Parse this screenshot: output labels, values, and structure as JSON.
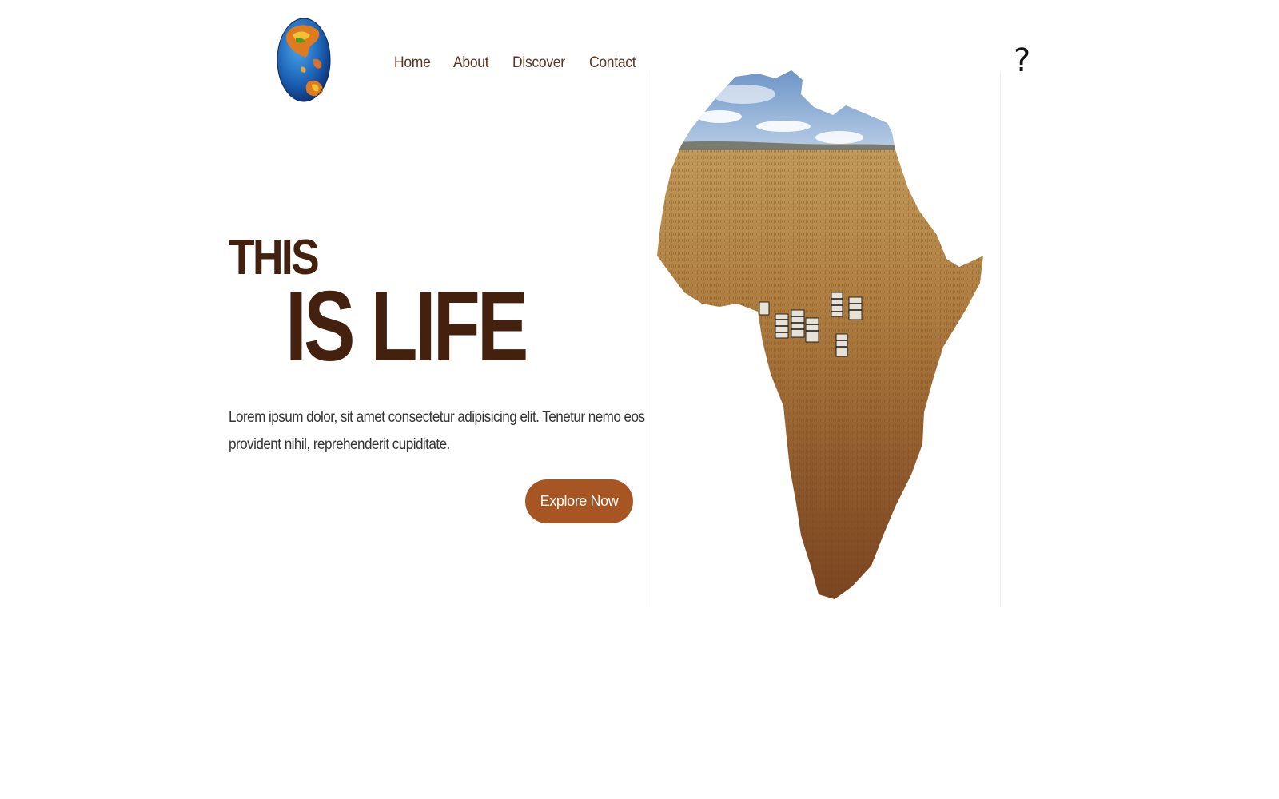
{
  "header": {
    "logo_icon": "globe-icon",
    "nav_items": [
      {
        "label": "Home"
      },
      {
        "label": "About"
      },
      {
        "label": "Discover"
      },
      {
        "label": "Contact"
      }
    ],
    "help_icon": "question-mark-icon",
    "help_glyph": "?"
  },
  "hero": {
    "title_line1": "THIS",
    "title_line2": "IS LIFE",
    "description": "Lorem ipsum dolor, sit amet consectetur adipisicing elit. Tenetur nemo eos provident nihil, reprehenderit cupiditate.",
    "cta_label": "Explore Now"
  },
  "media": {
    "image": "africa-map-savanna-zebras"
  },
  "colors": {
    "heading": "#43210e",
    "nav_text": "#5a3420",
    "button_bg": "#a65523",
    "button_text": "#ffffff",
    "body_text": "#333333"
  }
}
